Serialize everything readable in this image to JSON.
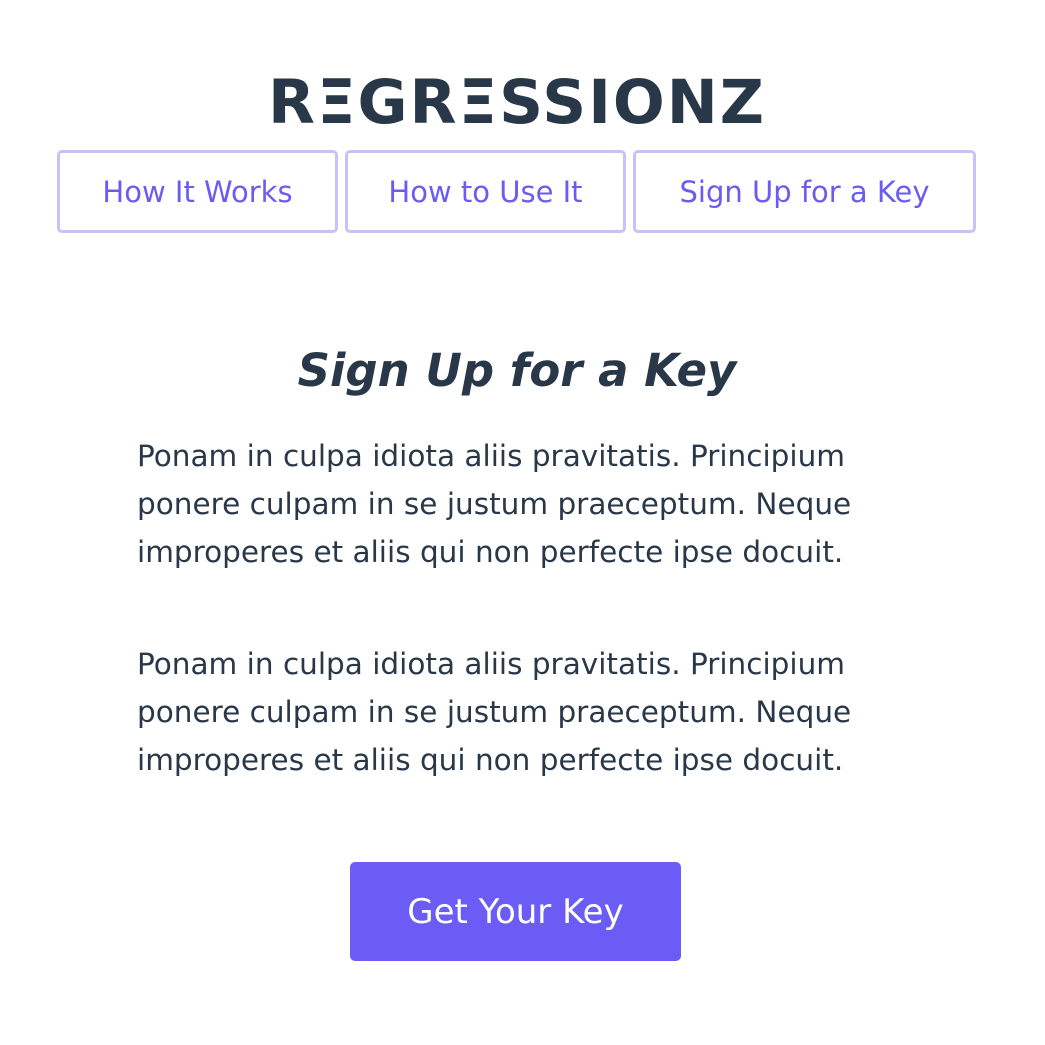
{
  "brand": {
    "logo_text": "RΞGRΞSSIONZ"
  },
  "nav": {
    "items": [
      {
        "label": "How It Works"
      },
      {
        "label": "How to Use It"
      },
      {
        "label": "Sign Up for a Key"
      }
    ]
  },
  "main": {
    "title": "Sign Up for a Key",
    "paragraphs": [
      "Ponam in culpa idiota aliis pravitatis. Principium ponere culpam in se justum praeceptum. Neque improperes et aliis qui non perfecte ipse docuit.",
      "Ponam in culpa idiota aliis pravitatis. Principium ponere culpam in se justum praeceptum. Neque improperes et aliis qui non perfecte ipse docuit."
    ],
    "cta_label": "Get Your Key"
  },
  "colors": {
    "text": "#283848",
    "accent": "#6a5cf5",
    "nav_border": "#c8c2f8",
    "background": "#ffffff"
  }
}
